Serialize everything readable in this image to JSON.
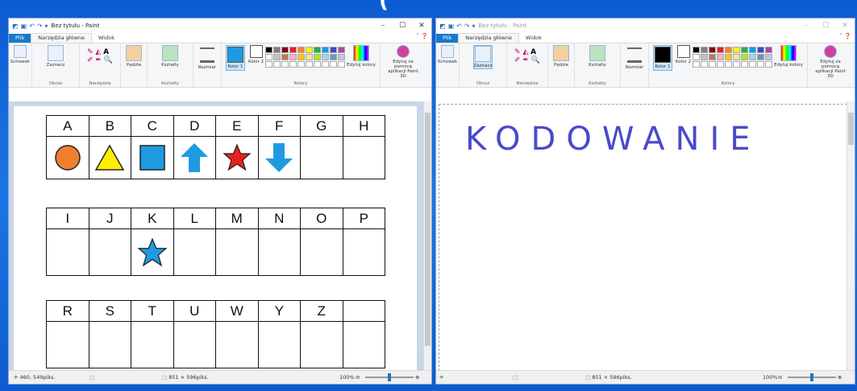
{
  "caption": "(",
  "left_window": {
    "title": "Bez tytułu - Paint",
    "tabs": [
      "Plik",
      "Narzędzia główne",
      "Widok"
    ],
    "ribbon": {
      "schowek": "Schowek",
      "zaznacz": "Zaznacz",
      "obraz": "Obraz",
      "narzedzia": "Narzędzia",
      "pedzle": "Pędzle",
      "ksztalty": "Kształty",
      "ksztalty_group": "Kształty",
      "rozmiar": "Rozmiar",
      "kolor1": "Kolor 1",
      "kolor2": "Kolor 2",
      "edytuj": "Edytuj kolory",
      "kolory": "Kolory",
      "paint3d": "Edytuj za pomocą aplikacji Paint 3D"
    },
    "status": {
      "pos": "460, 549piks.",
      "size": "851 × 596piks.",
      "zoom": "100%"
    },
    "grid1": {
      "letters": [
        "A",
        "B",
        "C",
        "D",
        "E",
        "F",
        "G",
        "H"
      ]
    },
    "grid2": {
      "letters": [
        "I",
        "J",
        "K",
        "L",
        "M",
        "N",
        "O",
        "P"
      ]
    },
    "grid3": {
      "letters": [
        "R",
        "S",
        "T",
        "U",
        "W",
        "Y",
        "Z",
        ""
      ]
    },
    "colors": {
      "orange": "#f08030",
      "yellow": "#ffee00",
      "blue": "#1e9be0",
      "red": "#e82020"
    }
  },
  "right_window": {
    "title": "Bez tytułu - Paint",
    "tabs": [
      "Plik",
      "Narzędzia główne",
      "Widok"
    ],
    "ribbon": {
      "schowek": "Schowek",
      "zaznacz": "Zaznacz",
      "obraz": "Obraz",
      "narzedzia": "Narzędzia",
      "pedzle": "Pędzle",
      "ksztalty": "Kształty",
      "ksztalty_group": "Kształty",
      "rozmiar": "Rozmiar",
      "kolor1": "Kolor 1",
      "kolor2": "Kolor 2",
      "edytuj": "Edytuj kolory",
      "kolory": "Kolory",
      "paint3d": "Edytuj za pomocą aplikacji Paint 3D"
    },
    "status": {
      "size": "851 × 596piks.",
      "zoom": "100%"
    },
    "canvas_text": "KODOWANIE"
  },
  "palette": [
    "#000000",
    "#7f7f7f",
    "#880015",
    "#ed1c24",
    "#ff7f27",
    "#fff200",
    "#22b14c",
    "#00a2e8",
    "#3f48cc",
    "#a349a4",
    "#ffffff",
    "#c3c3c3",
    "#b97a57",
    "#ffaec9",
    "#ffc90e",
    "#efe4b0",
    "#b5e61d",
    "#99d9ea",
    "#7092be",
    "#c8bfe7",
    "#ffffff",
    "#ffffff",
    "#ffffff",
    "#ffffff",
    "#ffffff",
    "#ffffff",
    "#ffffff",
    "#ffffff",
    "#ffffff",
    "#ffffff"
  ]
}
